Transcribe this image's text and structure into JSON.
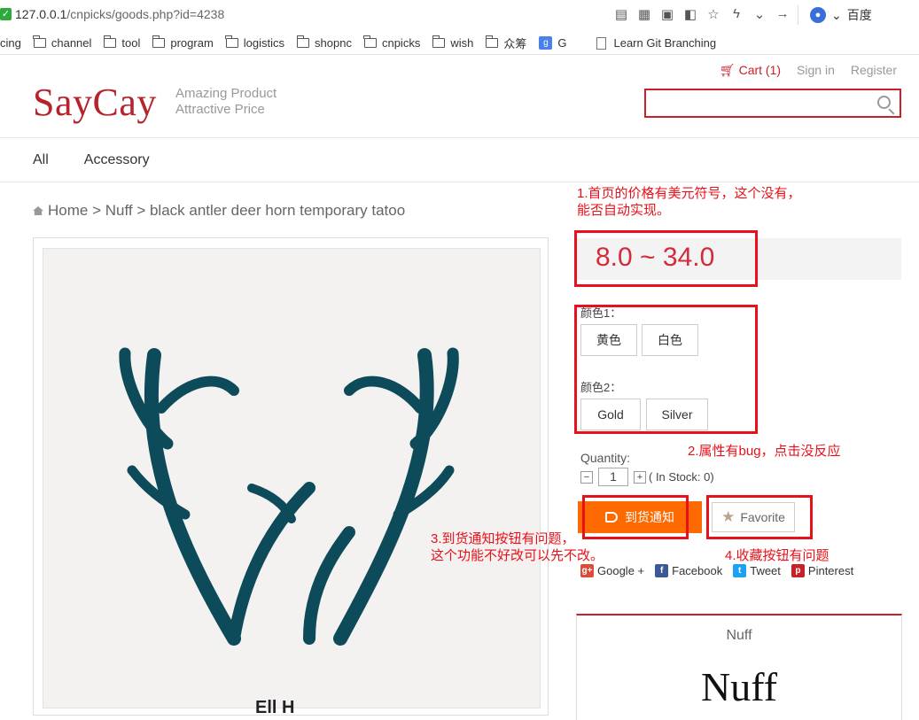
{
  "browser": {
    "url_host": "127.0.0.1",
    "url_path": "/cnpicks/goods.php?id=4238",
    "search_engine": "百度",
    "bookmarks": [
      {
        "label": "cing",
        "icon": "none"
      },
      {
        "label": "channel",
        "icon": "folder-icon"
      },
      {
        "label": "tool",
        "icon": "folder-icon"
      },
      {
        "label": "program",
        "icon": "folder-icon"
      },
      {
        "label": "logistics",
        "icon": "folder-icon"
      },
      {
        "label": "shopnc",
        "icon": "folder-icon"
      },
      {
        "label": "cnpicks",
        "icon": "folder-icon"
      },
      {
        "label": "wish",
        "icon": "folder-icon"
      },
      {
        "label": "众筹",
        "icon": "folder-icon"
      },
      {
        "label": "G",
        "icon": "google-icon"
      },
      {
        "label": "Learn Git Branching",
        "icon": "page-icon"
      }
    ]
  },
  "header": {
    "cart": "Cart (1)",
    "signin": "Sign in",
    "register": "Register",
    "logo": "SayCay",
    "tagline1": "Amazing Product",
    "tagline2": "Attractive Price",
    "search_placeholder": ""
  },
  "nav": {
    "all": "All",
    "accessory": "Accessory"
  },
  "breadcrumb": "Home > Nuff > black antler deer horn temporary tatoo",
  "product": {
    "price": "8.0 ~ 34.0",
    "attr1_label": "颜色1：",
    "attr1_options": [
      "黄色",
      "白色"
    ],
    "attr2_label": "颜色2：",
    "attr2_options": [
      "Gold",
      "Silver"
    ],
    "quantity_label": "Quantity:",
    "quantity_value": "1",
    "stock_text": "( In Stock: 0)",
    "notify_label": "到货通知",
    "favorite_label": "Favorite",
    "image_caption": "Ell  H"
  },
  "share": {
    "google": "Google +",
    "facebook": "Facebook",
    "tweet": "Tweet",
    "pinterest": "Pinterest"
  },
  "brand": {
    "name": "Nuff",
    "logo_text": "Nuff"
  },
  "annotations": {
    "note1_line1": "1.首页的价格有美元符号，这个没有，",
    "note1_line2": "能否自动实现。",
    "note2": "2.属性有bug，点击没反应",
    "note3_line1": "3.到货通知按钮有问题，",
    "note3_line2": "这个功能不好改可以先不改。",
    "note4": "4.收藏按钮有问题"
  },
  "colors": {
    "brand_red": "#b8222a",
    "price_red": "#d42a3a",
    "notify_orange": "#ff6a00",
    "annotation_red": "#e8101a",
    "antler": "#0d4a5a"
  }
}
